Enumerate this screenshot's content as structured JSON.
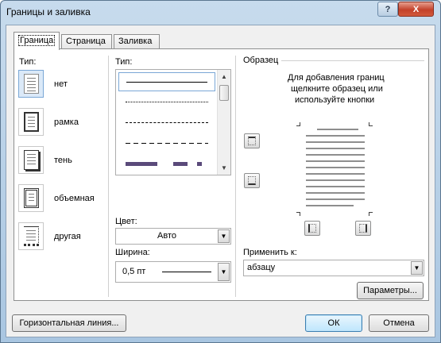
{
  "window": {
    "title": "Границы и заливка",
    "help_label": "?",
    "close_label": "X"
  },
  "tabs": [
    {
      "label": "Граница",
      "active": true
    },
    {
      "label": "Страница",
      "active": false
    },
    {
      "label": "Заливка",
      "active": false
    }
  ],
  "setting": {
    "label": "Тип:",
    "items": [
      {
        "label": "нет",
        "icon": "border-none-icon",
        "selected": true
      },
      {
        "label": "рамка",
        "icon": "border-box-icon",
        "selected": false
      },
      {
        "label": "тень",
        "icon": "border-shadow-icon",
        "selected": false
      },
      {
        "label": "объемная",
        "icon": "border-3d-icon",
        "selected": false
      },
      {
        "label": "другая",
        "icon": "border-custom-icon",
        "selected": false
      }
    ]
  },
  "style": {
    "label": "Тип:",
    "items": [
      "solid",
      "dotted",
      "dashed-small",
      "dashed-large",
      "dash-dot-thick"
    ]
  },
  "color": {
    "label": "Цвет:",
    "value": "Авто"
  },
  "width": {
    "label": "Ширина:",
    "value": "0,5 пт"
  },
  "preview": {
    "label": "Образец",
    "hint_line1": "Для добавления границ",
    "hint_line2": "щелкните образец или",
    "hint_line3": "используйте кнопки"
  },
  "apply_to": {
    "label": "Применить к:",
    "value": "абзацу"
  },
  "buttons": {
    "options": "Параметры...",
    "horizontal_line": "Горизонтальная линия...",
    "ok": "ОК",
    "cancel": "Отмена"
  },
  "colors": {
    "accent": "#5a4a7a",
    "selection_border": "#7aa7d6"
  }
}
